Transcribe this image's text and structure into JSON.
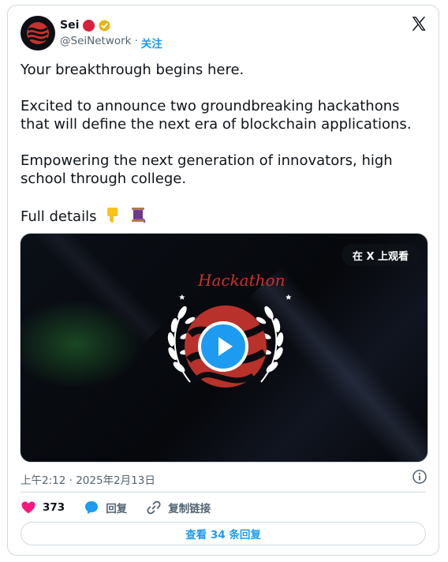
{
  "post": {
    "author_name": "Sei",
    "handle": "@SeiNetwork",
    "separator": "·",
    "follow_label": "关注",
    "paragraphs": [
      "Your breakthrough begins here.",
      "Excited to announce two groundbreaking hackathons that will define the next era of blockchain applications.",
      "Empowering the next generation of innovators, high school through college.",
      "Full details"
    ],
    "full_details_emojis": [
      "finger-pointing-down",
      "thread-spool"
    ]
  },
  "media": {
    "watch_on_x_label": "在 X 上观看",
    "artwork_text": "Hackathon",
    "type": "video"
  },
  "meta": {
    "timestamp": "上午2:12 · 2025年2月13日"
  },
  "actions": {
    "like_count": "373",
    "reply_label": "回复",
    "copy_link_label": "复制链接"
  },
  "replies_button": {
    "label": "查看 34 条回复"
  },
  "colors": {
    "accent": "#1d9bf0",
    "like": "#f91880",
    "brand_red": "#c8322e",
    "verified_gold": "#e2b719"
  },
  "icons": [
    "sei-logo-avatar",
    "red-dot-badge",
    "verified-badge-icon",
    "x-logo-icon",
    "play-icon",
    "info-icon",
    "heart-icon",
    "reply-bubble-icon",
    "link-icon"
  ]
}
